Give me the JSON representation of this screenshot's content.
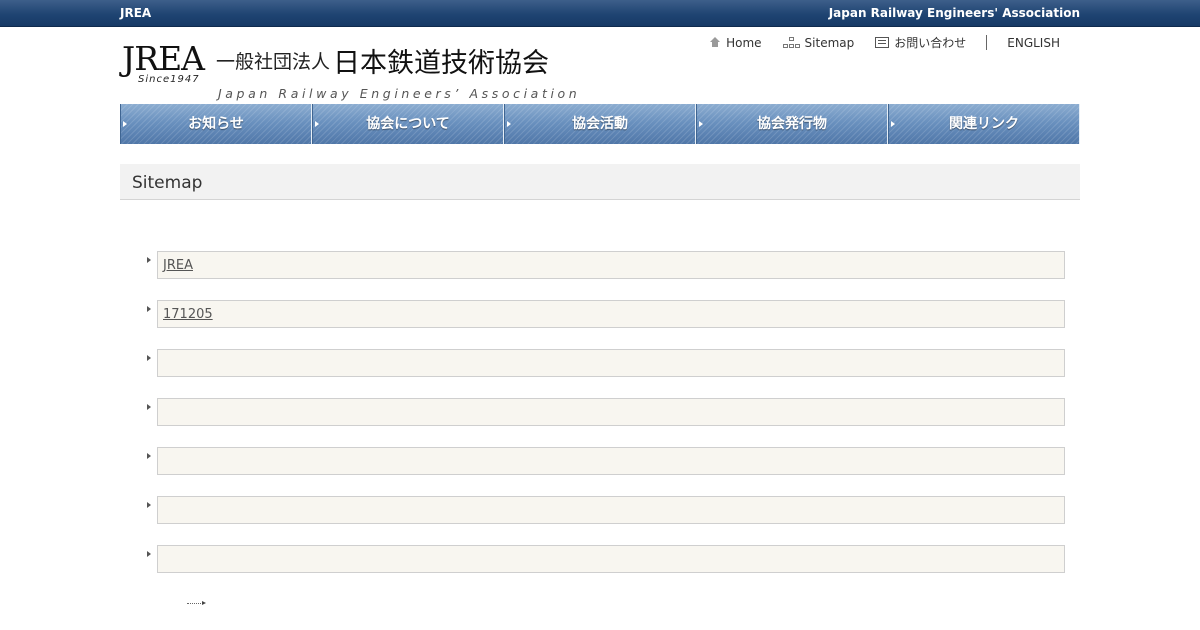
{
  "topbar": {
    "left": "JREA",
    "right": "Japan Railway Engineers' Association"
  },
  "logo": {
    "mark": "JREA",
    "since": "Since1947",
    "jp_small": "一般社団法人",
    "jp_big": "日本鉄道技術協会",
    "en": "Japan Railway Engineers’ Association"
  },
  "util_nav": {
    "home": "Home",
    "sitemap": "Sitemap",
    "contact": "お問い合わせ",
    "english": "ENGLISH"
  },
  "main_nav": [
    "お知らせ",
    "協会について",
    "協会活動",
    "協会発行物",
    "関連リンク"
  ],
  "page_title": "Sitemap",
  "sitemap_items": [
    "JREA ",
    "171205",
    "",
    "",
    "",
    "",
    ""
  ],
  "colors": {
    "topbar": "#1f4472",
    "nav": "#6a91bf",
    "item_bg": "#f8f6f0"
  }
}
